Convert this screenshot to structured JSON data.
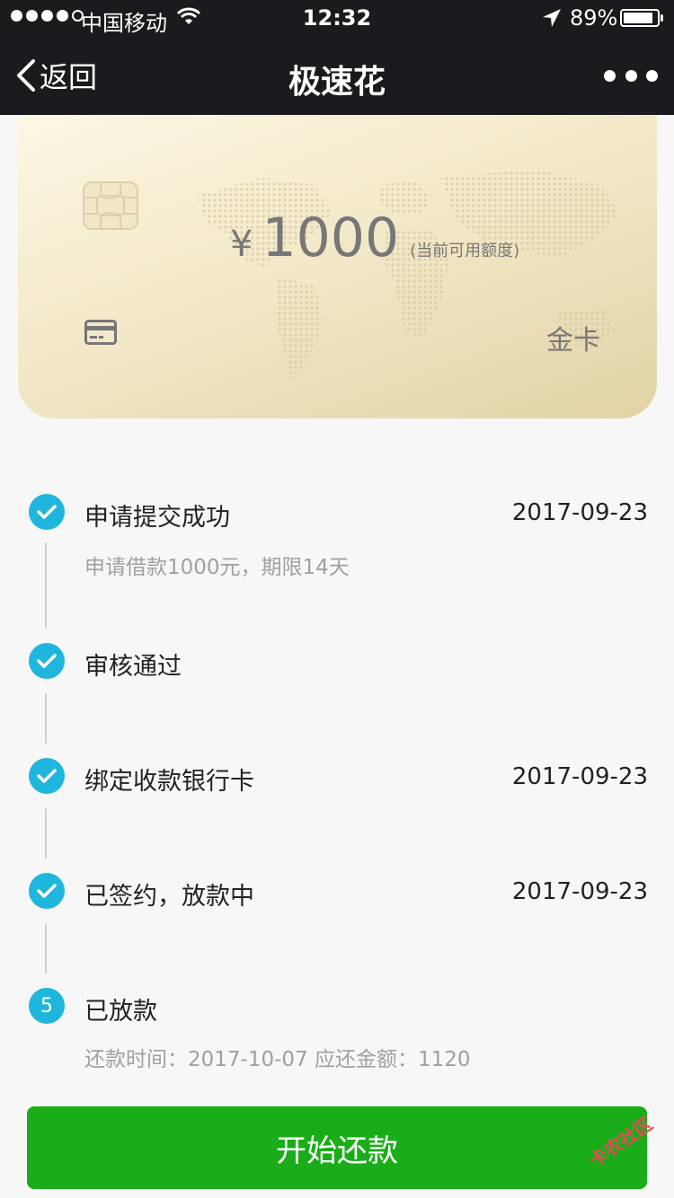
{
  "status_bar": {
    "carrier": "中国移动",
    "time": "12:32",
    "battery_pct": "89%",
    "battery_level": 0.89
  },
  "nav": {
    "back_label": "返回",
    "title": "极速花"
  },
  "card": {
    "currency": "¥",
    "amount": "1000",
    "amount_note": "(当前可用额度)",
    "tier": "金卡"
  },
  "timeline": [
    {
      "title": "申请提交成功",
      "date": "2017-09-23",
      "sub": "申请借款1000元，期限14天",
      "status": "done"
    },
    {
      "title": "审核通过",
      "date": "",
      "sub": "",
      "status": "done"
    },
    {
      "title": "绑定收款银行卡",
      "date": "2017-09-23",
      "sub": "",
      "status": "done"
    },
    {
      "title": "已签约，放款中",
      "date": "2017-09-23",
      "sub": "",
      "status": "done"
    },
    {
      "title": "已放款",
      "date": "",
      "sub": "还款时间：2017-10-07 应还金额：1120",
      "status": "current",
      "number": "5"
    }
  ],
  "action": {
    "repay_label": "开始还款"
  },
  "watermark": "卡农社区",
  "colors": {
    "accent": "#1fb6de",
    "button": "#1aad19",
    "header": "#1b1b1f"
  }
}
